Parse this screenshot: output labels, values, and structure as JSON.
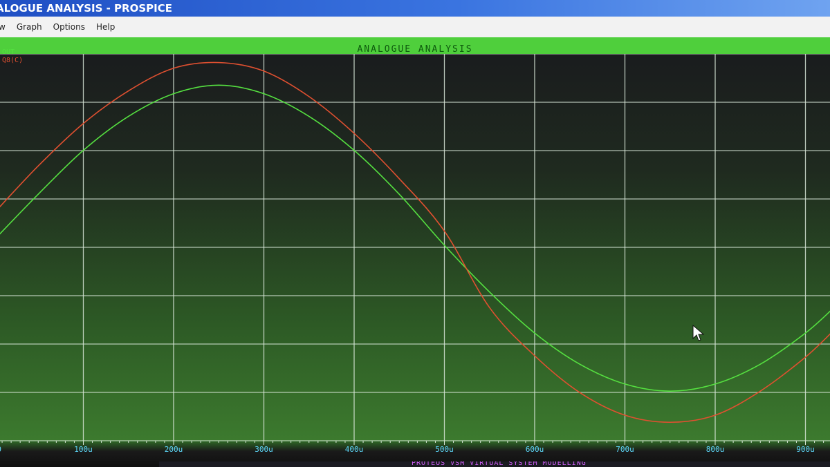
{
  "window": {
    "title": "ALOGUE ANALYSIS - PROSPICE"
  },
  "menu": {
    "items": [
      "w",
      "Graph",
      "Options",
      "Help"
    ]
  },
  "graph": {
    "title": "ANALOGUE ANALYSIS"
  },
  "status_bar": {
    "text": "PROTEUS VSM   VIRTUAL SYSTEM MODELLING"
  },
  "colors": {
    "out_trace": "#55e040",
    "q8_trace": "#e05030",
    "grid": "#d8e6d8",
    "axis_label": "#5fdcff"
  },
  "chart_data": {
    "type": "line",
    "title": "ANALOGUE ANALYSIS",
    "xlabel": "",
    "ylabel": "",
    "x_unit": "u",
    "xlim": [
      0,
      930
    ],
    "ylim": [
      -1.35,
      1.35
    ],
    "x_tick_labels": [
      "0",
      "100u",
      "200u",
      "300u",
      "400u",
      "500u",
      "600u",
      "700u",
      "800u",
      "900u"
    ],
    "grid": true,
    "legend_position": "top-left",
    "series": [
      {
        "name": "OUT",
        "color": "#55e040",
        "x": [
          0,
          50,
          100,
          150,
          200,
          250,
          300,
          350,
          400,
          450,
          500,
          550,
          600,
          650,
          700,
          750,
          800,
          850,
          900,
          930
        ],
        "y": [
          0.03,
          0.36,
          0.67,
          0.91,
          1.07,
          1.13,
          1.07,
          0.91,
          0.67,
          0.36,
          0.0,
          -0.33,
          -0.62,
          -0.84,
          -0.98,
          -1.03,
          -0.98,
          -0.84,
          -0.62,
          -0.45
        ]
      },
      {
        "name": "Q8(C)",
        "color": "#e05030",
        "x": [
          0,
          50,
          100,
          150,
          200,
          250,
          300,
          350,
          400,
          450,
          500,
          550,
          600,
          650,
          700,
          750,
          800,
          850,
          900,
          930
        ],
        "y": [
          0.22,
          0.56,
          0.86,
          1.09,
          1.25,
          1.29,
          1.23,
          1.05,
          0.79,
          0.47,
          0.1,
          -0.44,
          -0.78,
          -1.04,
          -1.2,
          -1.25,
          -1.2,
          -1.03,
          -0.79,
          -0.61
        ]
      }
    ]
  }
}
